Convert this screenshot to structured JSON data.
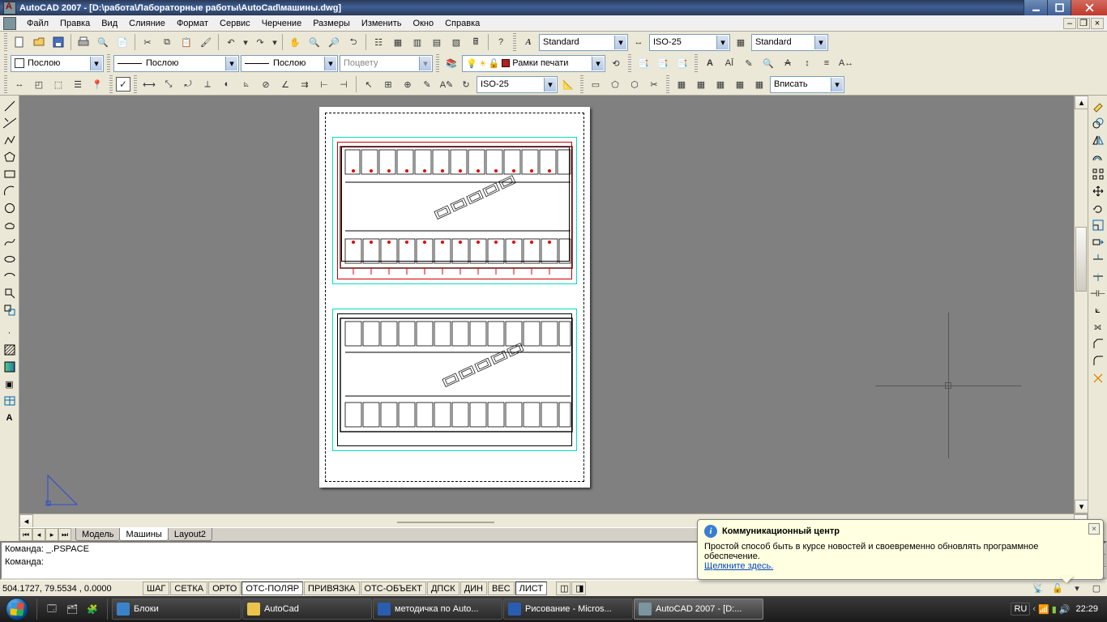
{
  "title": "AutoCAD 2007 - [D:\\работа\\Лабораторные работы\\AutoCad\\машины.dwg]",
  "menu": [
    "Файл",
    "Правка",
    "Вид",
    "Слияние",
    "Формат",
    "Сервис",
    "Черчение",
    "Размеры",
    "Изменить",
    "Окно",
    "Справка"
  ],
  "row2": {
    "layer": "Послою",
    "linetype": "Послою",
    "lineweight": "Послою",
    "plotstyle": "Поцвету",
    "print_frames": "Рамки печати"
  },
  "row1_right": {
    "textstyle": "Standard",
    "dimstyle": "ISO-25",
    "tablestyle": "Standard"
  },
  "row3": {
    "dimstyle2": "ISO-25",
    "viewport_scale": "Вписать"
  },
  "layout_tabs": [
    "Модель",
    "Машины",
    "Layout2"
  ],
  "active_tab": 1,
  "cmd": {
    "line1": "Команда: _.PSPACE",
    "line2": "Команда:"
  },
  "status": {
    "coord": "504.1727,  79.5534 , 0.0000",
    "toggles": [
      "ШАГ",
      "СЕТКА",
      "ОРТО",
      "ОТС-ПОЛЯР",
      "ПРИВЯЗКА",
      "ОТС-ОБЪЕКТ",
      "ДПСК",
      "ДИН",
      "ВЕС",
      "ЛИСТ"
    ],
    "toggles_on": [
      3,
      9
    ]
  },
  "balloon": {
    "title": "Коммуникационный центр",
    "body": "Простой способ быть в курсе новостей и своевременно обновлять программное обеспечение.",
    "link": "Щелкните здесь."
  },
  "taskbar": {
    "items": [
      {
        "label": "Блоки"
      },
      {
        "label": "AutoCad"
      },
      {
        "label": "методичка по Auto..."
      },
      {
        "label": "Рисование - Micros..."
      },
      {
        "label": "AutoCAD 2007 - [D:..."
      }
    ],
    "active": 4,
    "lang": "RU",
    "time": "22:29"
  }
}
